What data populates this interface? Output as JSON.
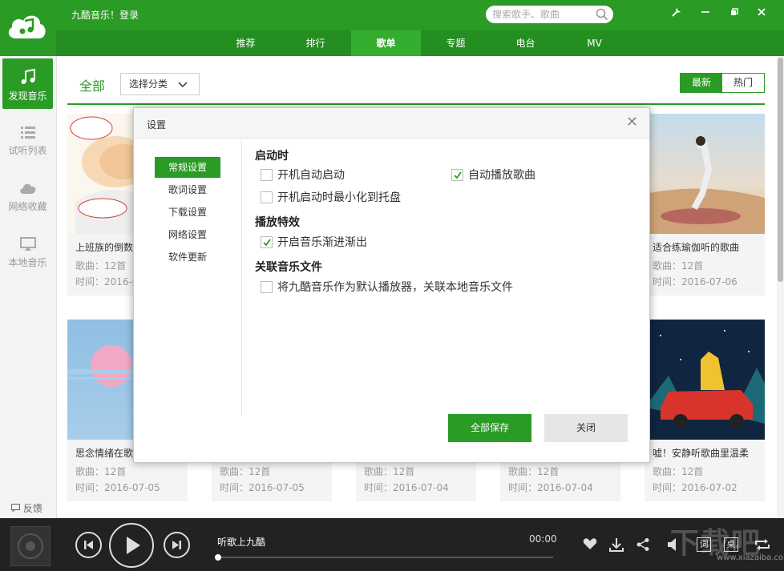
{
  "app": {
    "title": "九酷音乐！登录"
  },
  "search": {
    "placeholder": "搜索歌手、歌曲"
  },
  "nav": {
    "tabs": [
      "推荐",
      "排行",
      "歌单",
      "专题",
      "电台",
      "MV"
    ],
    "active_index": 2
  },
  "sidebar": {
    "items": [
      {
        "label": "发现音乐",
        "icon": "music-note-icon",
        "active": true
      },
      {
        "label": "试听列表",
        "icon": "list-icon",
        "active": false
      },
      {
        "label": "网络收藏",
        "icon": "cloud-icon",
        "active": false
      },
      {
        "label": "本地音乐",
        "icon": "monitor-icon",
        "active": false
      }
    ],
    "feedback": "反馈"
  },
  "main": {
    "category_all": "全部",
    "category_select": "选择分类",
    "sort": {
      "latest": "最新",
      "hot": "热门",
      "active": "latest"
    }
  },
  "cards": [
    {
      "title": "上班族的倒数",
      "count": "歌曲：12首",
      "time": "时间：2016-0"
    },
    {
      "title": "",
      "count": "",
      "time": ""
    },
    {
      "title": "",
      "count": "",
      "time": ""
    },
    {
      "title": "",
      "count": "",
      "time": ""
    },
    {
      "title": "适合练瑜伽听的歌曲",
      "count": "歌曲：12首",
      "time": "时间：2016-07-06"
    },
    {
      "title": "思念情绪在歌",
      "count": "歌曲：12首",
      "time": "时间：2016-07-05"
    },
    {
      "title": "",
      "count": "歌曲：12首",
      "time": "时间：2016-07-05"
    },
    {
      "title": "",
      "count": "歌曲：12首",
      "time": "时间：2016-07-04"
    },
    {
      "title": "",
      "count": "歌曲：12首",
      "time": "时间：2016-07-04"
    },
    {
      "title": "嘘！安静听歌曲里温柔",
      "count": "歌曲：12首",
      "time": "时间：2016-07-02"
    }
  ],
  "dialog": {
    "title": "设置",
    "nav": [
      "常规设置",
      "歌词设置",
      "下载设置",
      "网络设置",
      "软件更新"
    ],
    "active_nav": 0,
    "sections": {
      "startup": "启动时",
      "effects": "播放特效",
      "association": "关联音乐文件"
    },
    "options": {
      "auto_start": {
        "label": "开机自动启动",
        "checked": false
      },
      "auto_play": {
        "label": "自动播放歌曲",
        "checked": true
      },
      "minimize_tray": {
        "label": "开机启动时最小化到托盘",
        "checked": false
      },
      "fade": {
        "label": "开启音乐渐进渐出",
        "checked": true
      },
      "default_player": {
        "label": "将九酷音乐作为默认播放器，关联本地音乐文件",
        "checked": false
      }
    },
    "save_all": "全部保存",
    "close": "关闭"
  },
  "player": {
    "track": "听歌上九酷",
    "time": "00:00",
    "progress": 0,
    "lyrics_btn": "词",
    "desktop_btn": "桌"
  },
  "watermark": {
    "text": "下载吧",
    "url": "www.xiazaiba.com"
  },
  "colors": {
    "brand_green": "#2a9b25",
    "nav_green": "#248f20",
    "player_bg": "#222222"
  }
}
